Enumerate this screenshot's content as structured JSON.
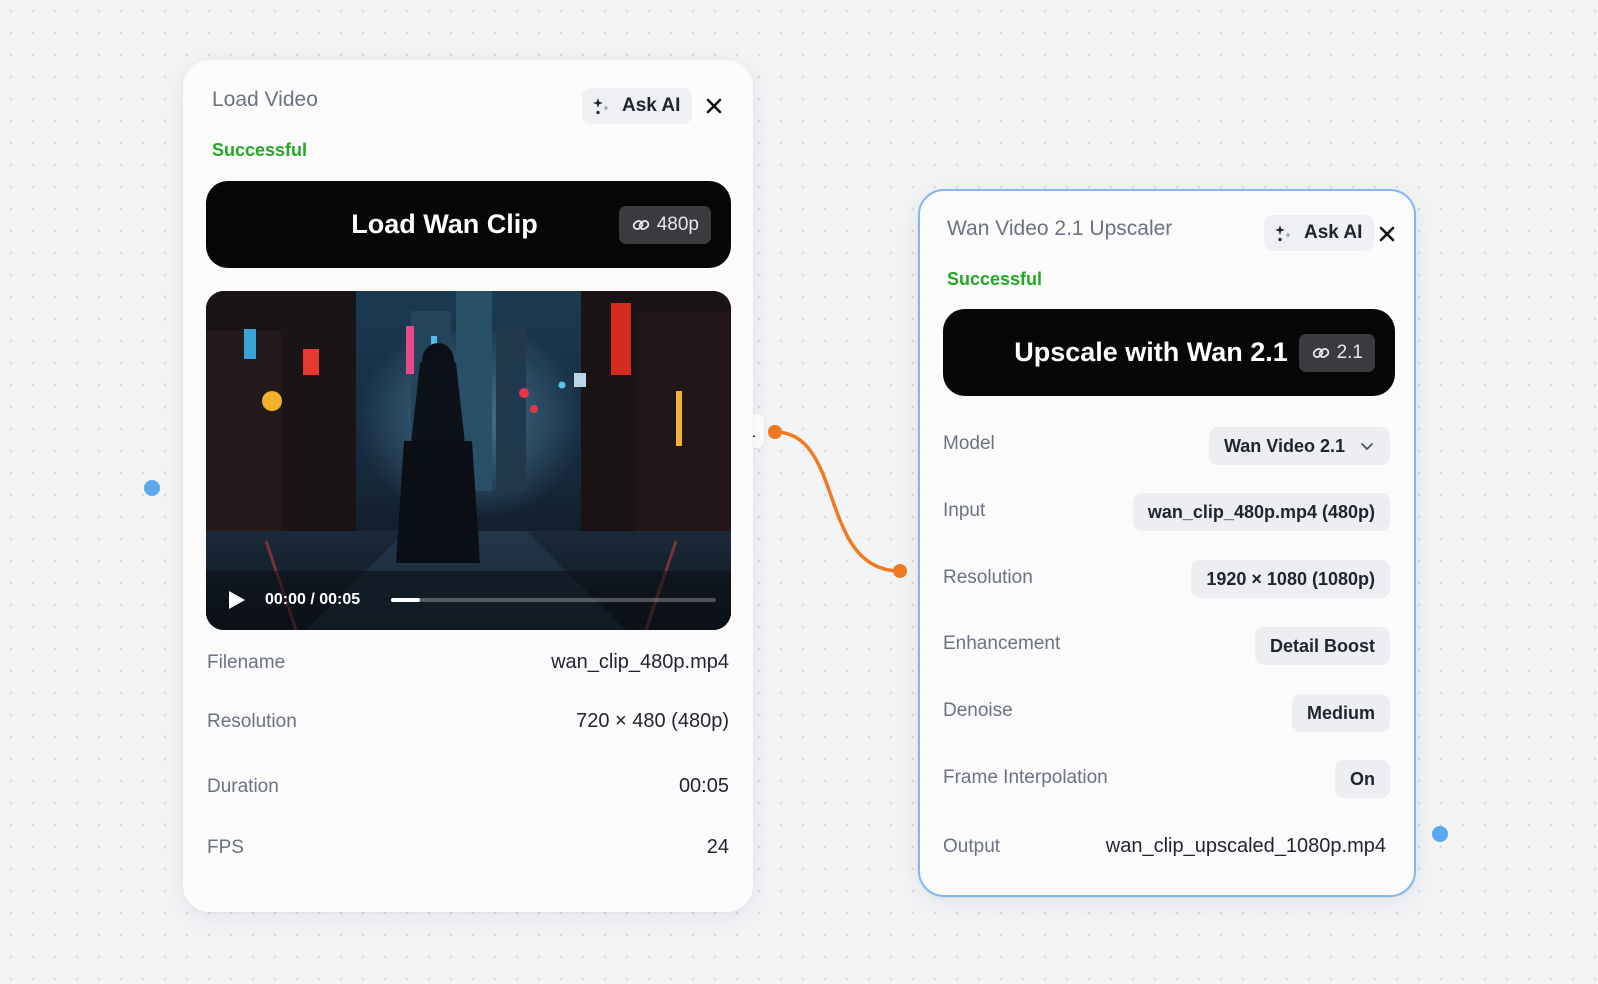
{
  "colors": {
    "status_success": "#22a822",
    "connection": "#f17a21",
    "port": "#5aa8ee",
    "selected_border": "#86b6ef"
  },
  "load_node": {
    "title": "Load Video",
    "ask_ai_label": "Ask AI",
    "ask_ai_icon": "sparkle-icon",
    "close_icon": "close-icon",
    "status": "Successful",
    "action_label": "Load Wan Clip",
    "action_chip": "480p",
    "action_chip_icon": "link-icon",
    "video": {
      "timecode": "00:00 / 00:05",
      "progress": 0.09
    },
    "fields": [
      {
        "label": "Filename",
        "value": "wan_clip_480p.mp4"
      },
      {
        "label": "Resolution",
        "value": "720 × 480 (480p)"
      },
      {
        "label": "Duration",
        "value": "00:05"
      },
      {
        "label": "FPS",
        "value": "24"
      }
    ]
  },
  "connection": {
    "output_index": "1"
  },
  "upscaler_node": {
    "title": "Wan Video 2.1 Upscaler",
    "ask_ai_label": "Ask AI",
    "ask_ai_icon": "sparkle-icon",
    "close_icon": "close-icon",
    "status": "Successful",
    "action_label": "Upscale with Wan 2.1",
    "action_chip": "2.1",
    "action_chip_icon": "link-icon",
    "fields": [
      {
        "label": "Model",
        "value": "Wan Video 2.1",
        "type": "select"
      },
      {
        "label": "Input",
        "value": "wan_clip_480p.mp4 (480p)",
        "type": "pill"
      },
      {
        "label": "Resolution",
        "value": "1920 × 1080 (1080p)",
        "type": "pill"
      },
      {
        "label": "Enhancement",
        "value": "Detail Boost",
        "type": "pill"
      },
      {
        "label": "Denoise",
        "value": "Medium",
        "type": "pill"
      },
      {
        "label": "Frame Interpolation",
        "value": "On",
        "type": "pill"
      },
      {
        "label": "Output",
        "value": "wan_clip_upscaled_1080p.mp4",
        "type": "text"
      }
    ]
  }
}
